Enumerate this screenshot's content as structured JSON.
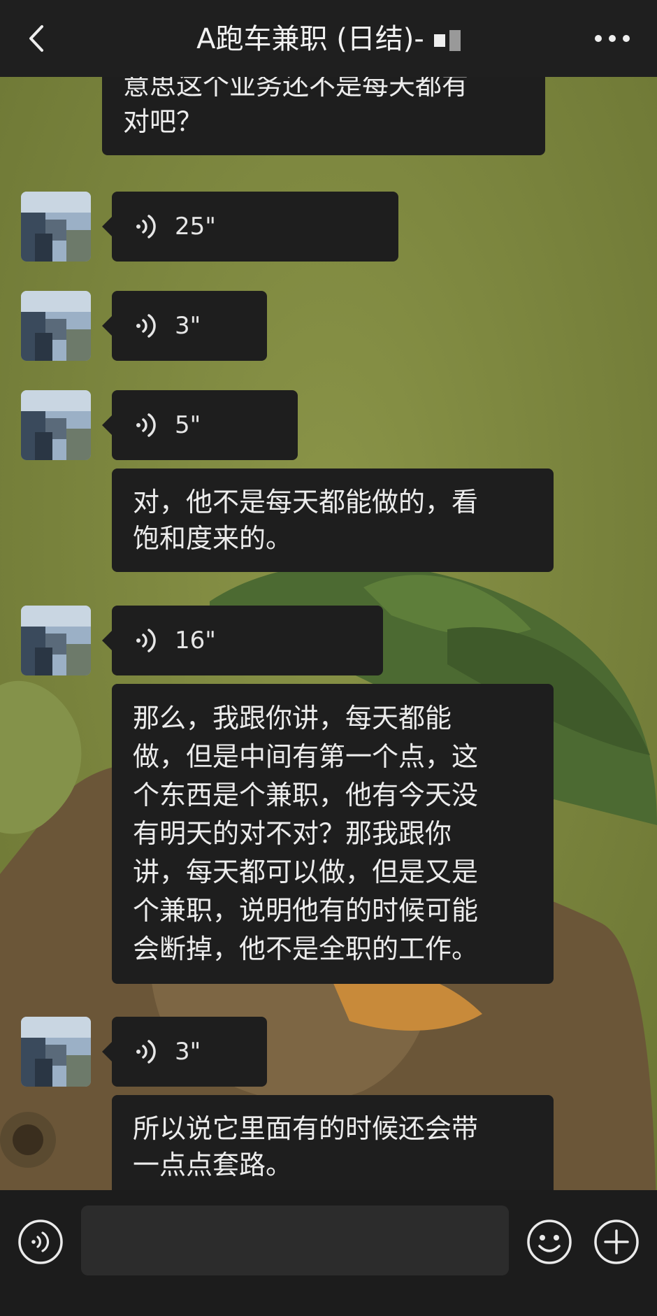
{
  "header": {
    "title": "A跑车兼职 (日结)-",
    "back_icon": "chevron-left-icon",
    "more_icon": "more-horizontal-icon"
  },
  "messages": [
    {
      "type": "text",
      "text_lines": [
        "意思这个业务还不是每天都有",
        "对吧？"
      ]
    },
    {
      "type": "voice",
      "duration": "25\""
    },
    {
      "type": "voice",
      "duration": "3\""
    },
    {
      "type": "voice",
      "duration": "5\""
    },
    {
      "type": "text",
      "text_lines": [
        "对，他不是每天都能做的，看",
        "饱和度来的。"
      ]
    },
    {
      "type": "voice",
      "duration": "16\""
    },
    {
      "type": "text",
      "text_lines": [
        "那么，我跟你讲，每天都能",
        "做，但是中间有第一个点，这",
        "个东西是个兼职，他有今天没",
        "有明天的对不对？那我跟你",
        "讲，每天都可以做，但是又是",
        "个兼职，说明他有的时候可能",
        "会断掉，他不是全职的工作。"
      ]
    },
    {
      "type": "voice",
      "duration": "3\""
    },
    {
      "type": "text",
      "text_lines": [
        "所以说它里面有的时候还会带",
        "一点点套路。"
      ]
    }
  ],
  "input_bar": {
    "voice_icon": "voice-toggle-icon",
    "placeholder": "",
    "emoji_icon": "emoji-icon",
    "plus_icon": "plus-circle-icon"
  },
  "colors": {
    "bar_background": "#1f1f1f",
    "bubble_background": "#1e1e1e",
    "text": "#ececec",
    "wallpaper": "#7a8640"
  }
}
